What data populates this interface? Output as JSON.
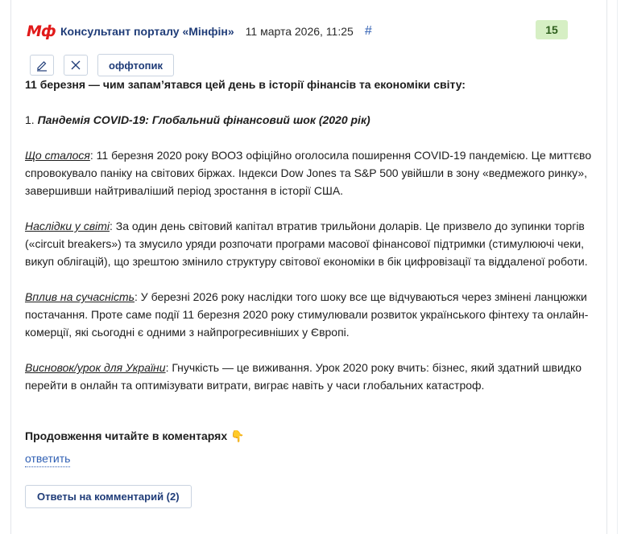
{
  "post": {
    "logo_text": "Мф",
    "author": "Консультант порталу «Мінфін»",
    "date": "11 марта 2026, 11:25",
    "hash": "#",
    "score": "15"
  },
  "toolbar": {
    "edit_icon": "pencil-icon",
    "close_icon": "close-icon",
    "tag_label": "оффтопик"
  },
  "content": {
    "intro": "11 березня — чим запам’ятався цей день в історії фінансів та економіки світу:",
    "item_number": "1.",
    "item_title": "Пандемія COVID-19: Глобальний фінансовий шок (2020 рік)",
    "p1_label": "Що сталося",
    "p1_text": ": 11 березня 2020 року ВООЗ офіційно оголосила поширення COVID-19 пандемією. Це миттєво спровокувало паніку на світових біржах. Індекси Dow Jones та S&P 500 увійшли в зону «ведмежого ринку», завершивши найтриваліший період зростання в історії США.",
    "p2_label": "Наслідки у світі",
    "p2_text": ": За один день світовий капітал втратив трильйони доларів. Це призвело до зупинки торгів («circuit breakers») та змусило уряди розпочати програми масової фінансової підтримки (стимулюючі чеки, викуп облігацій), що зрештою змінило структуру світової економіки в бік цифровізації та віддаленої роботи.",
    "p3_label": "Вплив на сучасність",
    "p3_text": ": У березні 2026 року наслідки того шоку все ще відчуваються через змінені ланцюжки постачання. Проте саме події 11 березня 2020 року стимулювали розвиток українського фінтеху та онлайн-комерції, які сьогодні є одними з найпрогресивніших у Європі.",
    "p4_label": "Висновок/урок для України",
    "p4_text": ": Гнучкість — це виживання. Урок 2020 року вчить: бізнес, який здатний швидко перейти в онлайн та оптимізувати витрати, виграє навіть у часи глобальних катастроф.",
    "continue_text": "Продовження читайте в коментарях",
    "continue_emoji": "👇"
  },
  "actions": {
    "reply": "ответить",
    "answers": "Ответы на комментарий (2)"
  },
  "colors": {
    "brand_red": "#e11a1a",
    "author_blue": "#1f3c78",
    "link_blue": "#2f5fb3",
    "score_bg": "#d6efc4"
  }
}
